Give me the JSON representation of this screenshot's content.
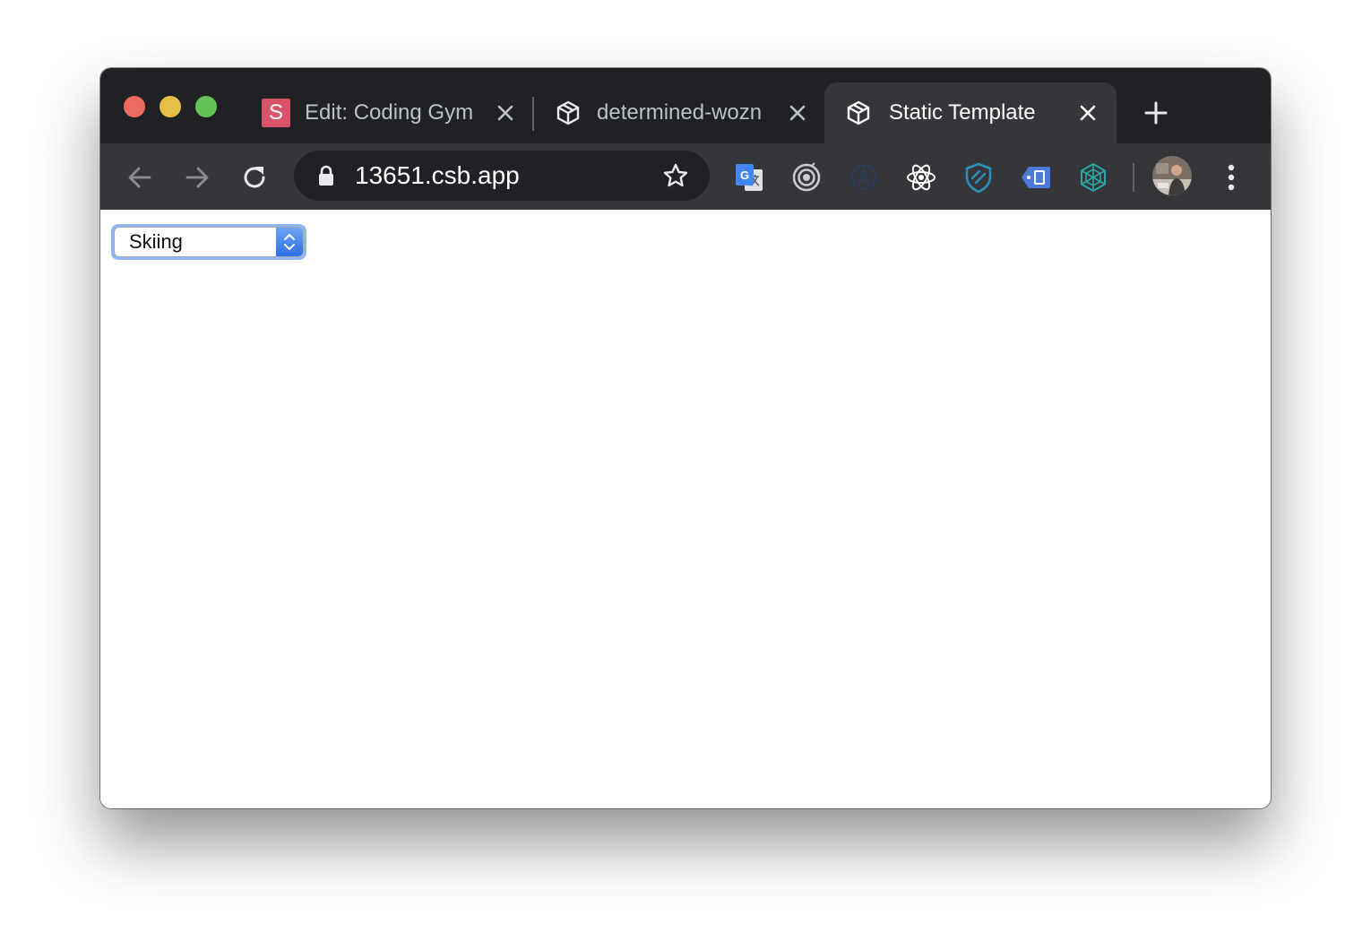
{
  "browser": {
    "tabs": [
      {
        "title": "Edit: Coding Gym",
        "favicon": "sandbox-s-icon",
        "favicon_letter": "S",
        "active": false
      },
      {
        "title": "determined-wozn",
        "favicon": "codesandbox-cube-icon",
        "active": false
      },
      {
        "title": "Static Template",
        "favicon": "codesandbox-cube-icon",
        "active": true
      }
    ],
    "address_bar": {
      "url": "13651.csb.app"
    },
    "extensions": [
      "google-translate-icon",
      "target-icon",
      "angular-devtools-icon",
      "react-devtools-icon",
      "shield-icon",
      "tag-icon",
      "web-icon"
    ]
  },
  "page": {
    "select": {
      "selected": "Skiing"
    }
  },
  "colors": {
    "tab_strip": "#202124",
    "toolbar": "#35363a",
    "omnibox": "#202124",
    "select_focus": "#8fb6f5",
    "select_arrow": "#2f6fe6"
  }
}
